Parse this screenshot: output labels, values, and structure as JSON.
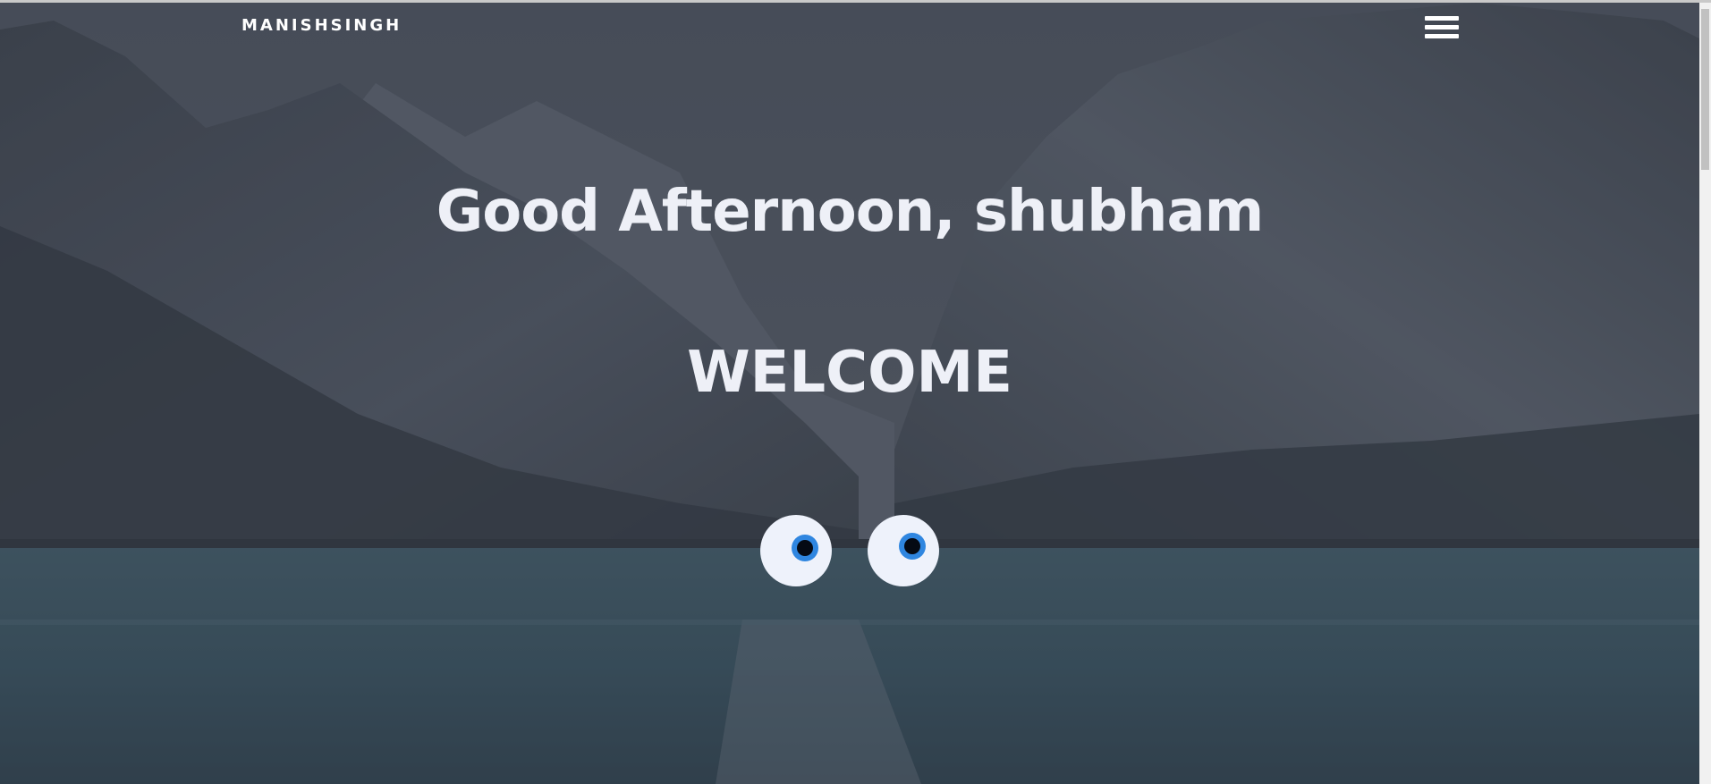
{
  "header": {
    "brand": "MANISHSINGH",
    "menu_icon": "hamburger-menu-icon"
  },
  "hero": {
    "greeting": "Good Afternoon, shubham",
    "welcome": "WELCOME",
    "background": "snowy-mountain-lake-photo",
    "overlay_color": "#3b4250"
  },
  "eyes": {
    "icon": "eyes-icon",
    "sclera_color": "#eef2fb",
    "iris_color": "#2f86e0",
    "pupil_color": "#050a14"
  },
  "colors": {
    "heading_text": "#eef0f7",
    "brand_text": "#ffffff"
  }
}
